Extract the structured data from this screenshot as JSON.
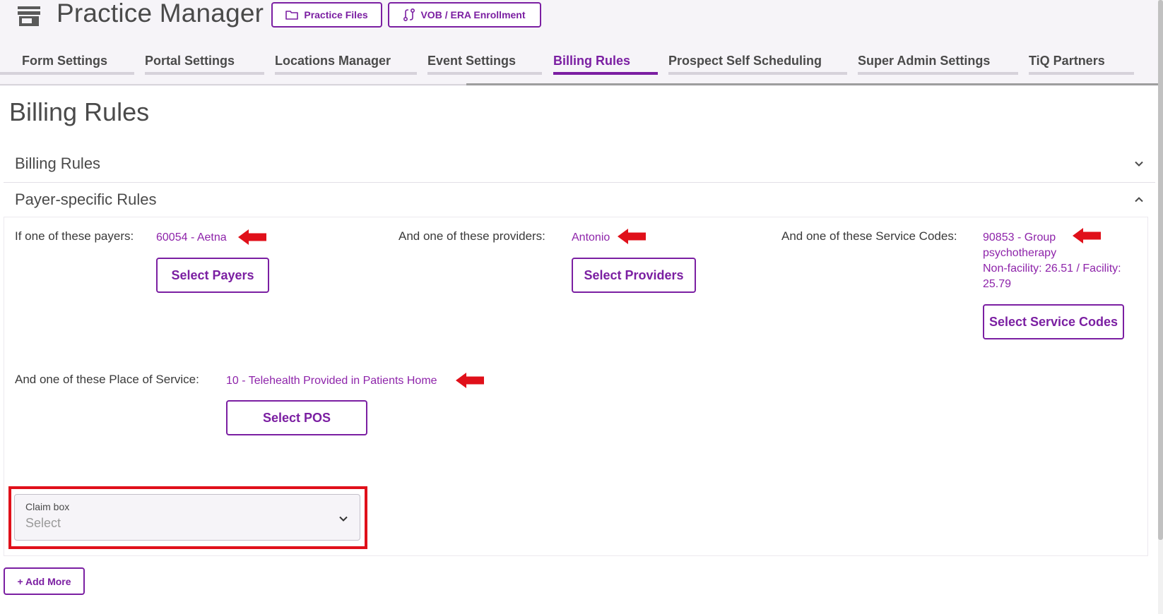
{
  "app": {
    "title": "Practice Manager",
    "icon": "store-icon",
    "accent_color": "#7b1fa2",
    "buttons": {
      "practice_files": "Practice Files",
      "vob_era": "VOB / ERA Enrollment"
    }
  },
  "tabs": [
    {
      "label": "Form Settings",
      "active": false
    },
    {
      "label": "Portal Settings",
      "active": false
    },
    {
      "label": "Locations Manager",
      "active": false
    },
    {
      "label": "Event Settings",
      "active": false
    },
    {
      "label": "Billing Rules",
      "active": true
    },
    {
      "label": "Prospect Self Scheduling",
      "active": false
    },
    {
      "label": "Super Admin Settings",
      "active": false
    },
    {
      "label": "TiQ Partners",
      "active": false
    }
  ],
  "page": {
    "title": "Billing Rules"
  },
  "sections": {
    "billing_rules": {
      "title": "Billing Rules",
      "expanded": false
    },
    "payer_rules": {
      "title": "Payer-specific Rules",
      "expanded": true
    }
  },
  "rules": {
    "payers": {
      "label": "If one of these payers:",
      "value": "60054 - Aetna",
      "button": "Select Payers"
    },
    "providers": {
      "label": "And one of these providers:",
      "value": "Antonio",
      "button": "Select Providers"
    },
    "service_codes": {
      "label": "And one of these Service Codes:",
      "value_line1": "90853 - Group",
      "value_line2": "psychotherapy",
      "value_line3": "Non-facility: 26.51 / Facility:",
      "value_line4": "25.79",
      "button": "Select Service Codes"
    },
    "pos": {
      "label": "And one of these Place of Service:",
      "value": "10 - Telehealth Provided in Patients Home",
      "button": "Select POS"
    },
    "claim_box": {
      "label": "Claim box",
      "value": "Select"
    }
  },
  "actions": {
    "add_more": "+ Add More"
  },
  "annotation_color": "#e0101a"
}
